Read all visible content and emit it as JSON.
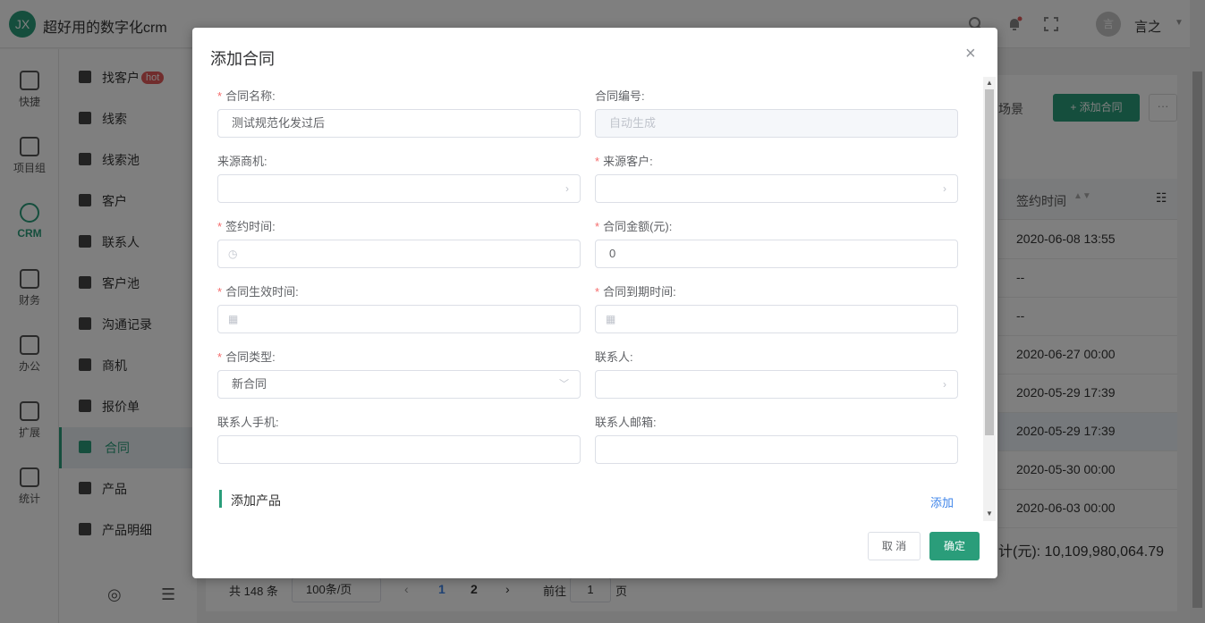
{
  "app": {
    "logo": "JX",
    "title": "超好用的数字化crm"
  },
  "header": {
    "user_avatar": "言",
    "user_name": "言之"
  },
  "rail": [
    {
      "label": "快捷",
      "icon": "home-icon"
    },
    {
      "label": "项目组",
      "icon": "document-icon"
    },
    {
      "label": "CRM",
      "icon": "heart-icon"
    },
    {
      "label": "财务",
      "icon": "yen-icon"
    },
    {
      "label": "办公",
      "icon": "monitor-icon"
    },
    {
      "label": "扩展",
      "icon": "extend-icon"
    },
    {
      "label": "统计",
      "icon": "chart-icon"
    }
  ],
  "subnav": [
    {
      "label": "找客户",
      "badge": "hot"
    },
    {
      "label": "线索"
    },
    {
      "label": "线索池"
    },
    {
      "label": "客户"
    },
    {
      "label": "联系人"
    },
    {
      "label": "客户池"
    },
    {
      "label": "沟通记录"
    },
    {
      "label": "商机"
    },
    {
      "label": "报价单"
    },
    {
      "label": "合同"
    },
    {
      "label": "产品"
    },
    {
      "label": "产品明细"
    }
  ],
  "toolbar": {
    "scene_label": "场景",
    "add_label": "+ 添加合同",
    "more_label": "···"
  },
  "table": {
    "column_header": "签约时间",
    "rows": [
      "2020-06-08 13:55",
      "--",
      "--",
      "2020-06-27 00:00",
      "2020-05-29 17:39",
      "2020-05-29 17:39",
      "2020-05-30 00:00",
      "2020-06-03 00:00"
    ]
  },
  "summary": {
    "total_text": "计(元):  10,109,980,064.79"
  },
  "pager": {
    "total": "共 148 条",
    "page_size": "100条/页",
    "page_1": "1",
    "page_2": "2",
    "goto_label": "前往",
    "goto_value": "1",
    "page_unit": "页"
  },
  "dialog": {
    "title": "添加合同",
    "fields": {
      "contract_name": {
        "label": "合同名称:",
        "value": "测试规范化发过后"
      },
      "contract_no": {
        "label": "合同编号:",
        "placeholder": "自动生成"
      },
      "source_opportunity": {
        "label": "来源商机:"
      },
      "source_customer": {
        "label": "来源客户:"
      },
      "sign_time": {
        "label": "签约时间:"
      },
      "amount": {
        "label": "合同金额(元):",
        "value": "0"
      },
      "effective_time": {
        "label": "合同生效时间:"
      },
      "expire_time": {
        "label": "合同到期时间:"
      },
      "contract_type": {
        "label": "合同类型:",
        "value": "新合同"
      },
      "contact": {
        "label": "联系人:"
      },
      "contact_phone": {
        "label": "联系人手机:"
      },
      "contact_email": {
        "label": "联系人邮箱:"
      }
    },
    "product_section": {
      "title": "添加产品",
      "add_label": "添加"
    },
    "cancel_label": "取 消",
    "ok_label": "确定"
  },
  "colors": {
    "accent": "#2a9d7a",
    "required": "#f56c6c",
    "link": "#3e84e9"
  }
}
